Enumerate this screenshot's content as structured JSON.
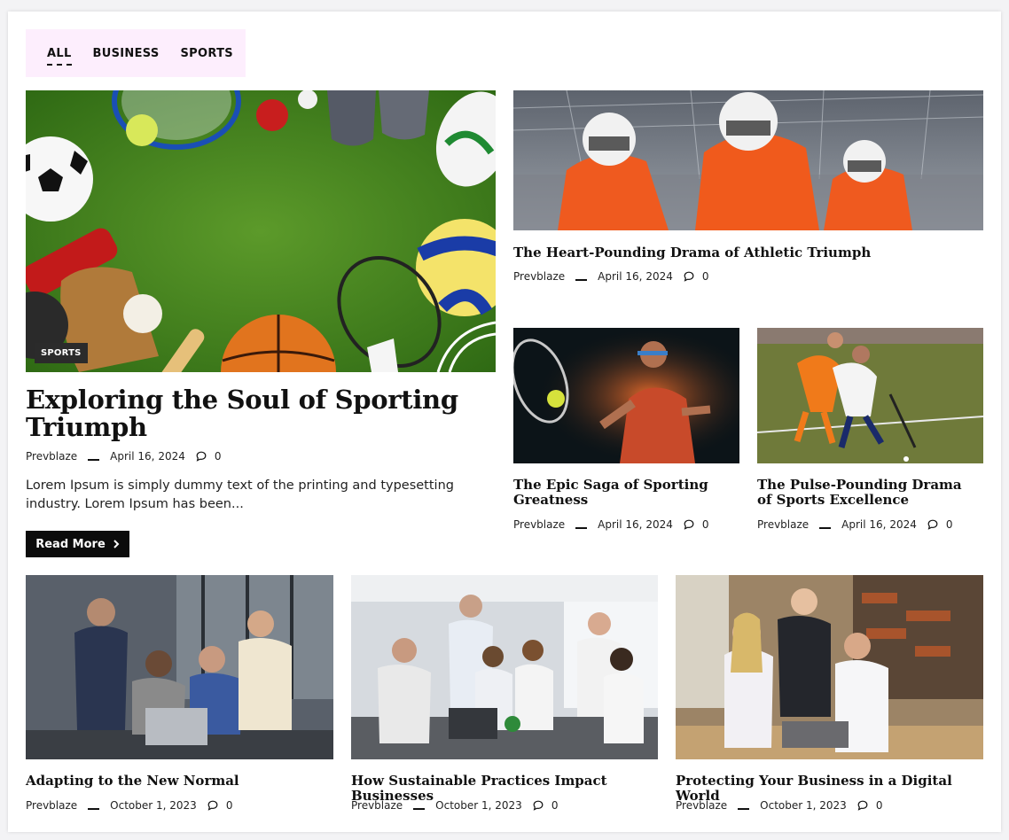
{
  "tabs": [
    {
      "label": "ALL",
      "active": true
    },
    {
      "label": "BUSINESS",
      "active": false
    },
    {
      "label": "SPORTS",
      "active": false
    }
  ],
  "featured": {
    "category": "SPORTS",
    "title": "Exploring the Soul of Sporting Triumph",
    "author": "Prevblaze",
    "date": "April 16, 2024",
    "comments": "0",
    "excerpt": "Lorem Ipsum is simply dummy text of the printing and typesetting industry. Lorem Ipsum has been...",
    "read_more": "Read More"
  },
  "posts": [
    {
      "title": "The Heart-Pounding Drama of Athletic Triumph",
      "author": "Prevblaze",
      "date": "April 16, 2024",
      "comments": "0"
    },
    {
      "title": "The Epic Saga of Sporting Greatness",
      "author": "Prevblaze",
      "date": "April 16, 2024",
      "comments": "0"
    },
    {
      "title": "The Pulse-Pounding Drama of Sports Excellence",
      "author": "Prevblaze",
      "date": "April 16, 2024",
      "comments": "0"
    },
    {
      "title": "Adapting to the New Normal",
      "author": "Prevblaze",
      "date": "October 1, 2023",
      "comments": "0"
    },
    {
      "title": "How Sustainable Practices Impact Businesses",
      "author": "Prevblaze",
      "date": "October 1, 2023",
      "comments": "0"
    },
    {
      "title": "Protecting Your Business in a Digital World",
      "author": "Prevblaze",
      "date": "October 1, 2023",
      "comments": "0"
    }
  ],
  "icons": {
    "comment": "comment-icon",
    "chevron": "chevron-right-icon"
  },
  "colors": {
    "tab_bg": "#fdeefd",
    "badge_bg": "#2b2b2b",
    "button_bg": "#0c0c0c"
  }
}
